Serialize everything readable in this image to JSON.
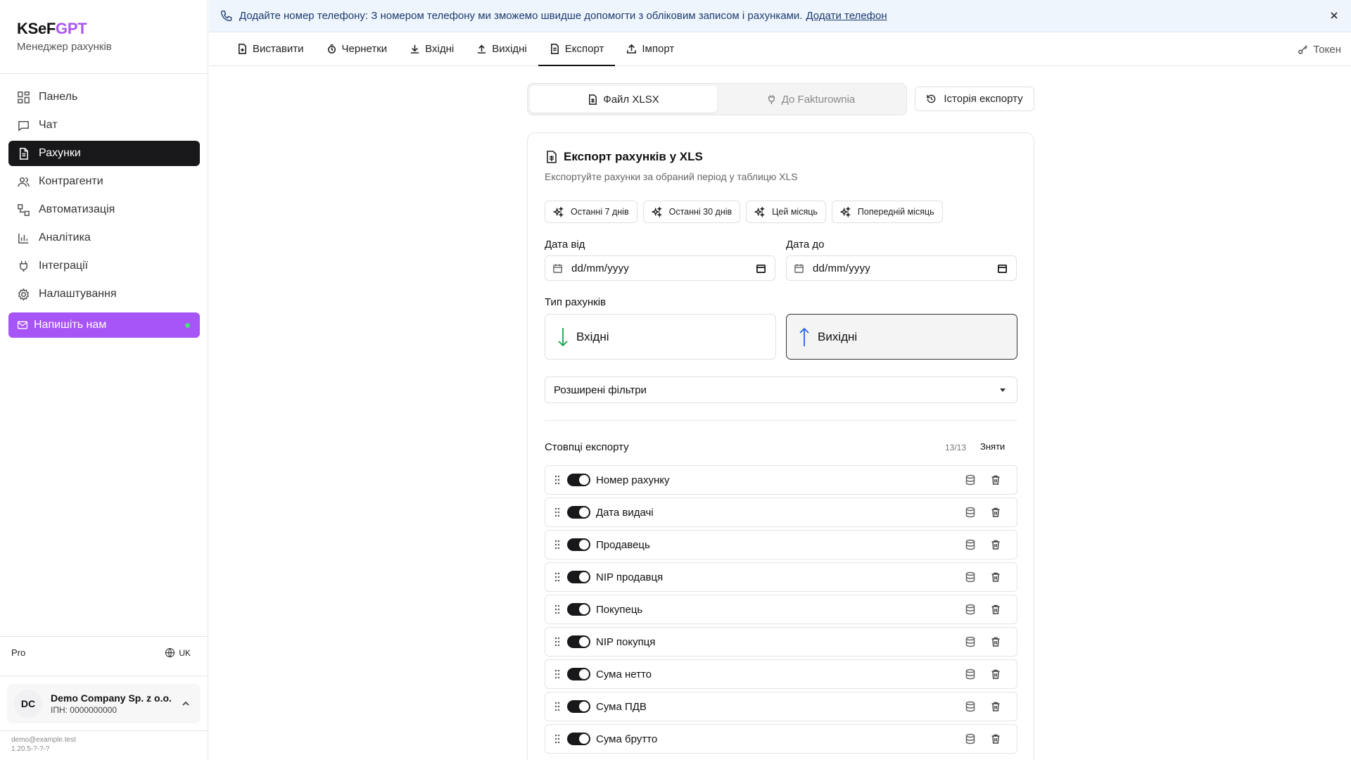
{
  "sidebar": {
    "brand_prefix": "KSeF",
    "brand_suffix": "GPT",
    "subtitle": "Менеджер рахунків",
    "items": [
      {
        "label": "Панель",
        "icon": "dashboard-icon"
      },
      {
        "label": "Чат",
        "icon": "chat-icon"
      },
      {
        "label": "Рахунки",
        "icon": "invoice-icon",
        "active": true
      },
      {
        "label": "Контрагенти",
        "icon": "users-icon"
      },
      {
        "label": "Автоматизація",
        "icon": "workflow-icon"
      },
      {
        "label": "Аналітика",
        "icon": "chart-icon"
      },
      {
        "label": "Інтеграції",
        "icon": "plug-icon"
      },
      {
        "label": "Налаштування",
        "icon": "gear-icon"
      }
    ],
    "contact_label": "Напишіть нам",
    "plan": "Pro",
    "language": "UK",
    "company": {
      "initials": "DC",
      "name": "Demo Company Sp. z o.o.",
      "nip": "ІПН: 0000000000"
    },
    "email": "demo@example.test",
    "version": "1.20.5-?-?-?"
  },
  "banner": {
    "text": "Додайте номер телефону: З номером телефону ми зможемо швидше допомогти з обліковим записом і рахунками.",
    "link": "Додати телефон"
  },
  "tabs": [
    {
      "label": "Виставити",
      "icon": "file-plus-icon"
    },
    {
      "label": "Чернетки",
      "icon": "draft-icon"
    },
    {
      "label": "Вхідні",
      "icon": "download-icon"
    },
    {
      "label": "Вихідні",
      "icon": "upload-icon"
    },
    {
      "label": "Експорт",
      "icon": "file-export-icon",
      "active": true
    },
    {
      "label": "Імпорт",
      "icon": "import-icon"
    }
  ],
  "token_label": "Токен",
  "export_mode": {
    "xlsx": "Файл XLSX",
    "fakturownia": "До Fakturownia",
    "history": "Історія експорту"
  },
  "card": {
    "title": "Експорт рахунків у XLS",
    "subtitle": "Експортуйте рахунки за обраний період у таблицю XLS",
    "presets": [
      "Останні 7 днів",
      "Останні 30 днів",
      "Цей місяць",
      "Попередній місяць"
    ],
    "date_from_label": "Дата від",
    "date_to_label": "Дата до",
    "date_placeholder": "dd/mm/yyyy",
    "type_label": "Тип рахунків",
    "type_incoming": "Вхідні",
    "type_outgoing": "Вихідні",
    "filters_label": "Розширені фільтри",
    "columns_title": "Стовпці експорту",
    "columns_count": "13/13",
    "columns_clear": "Зняти",
    "columns": [
      "Номер рахунку",
      "Дата видачі",
      "Продавець",
      "NIP продавця",
      "Покупець",
      "NIP покупця",
      "Сума нетто",
      "Сума ПДВ",
      "Сума брутто"
    ]
  },
  "colors": {
    "accent": "#a855f7",
    "dark": "#18181b",
    "incoming_arrow": "#16a34a",
    "outgoing_arrow": "#2563eb"
  }
}
